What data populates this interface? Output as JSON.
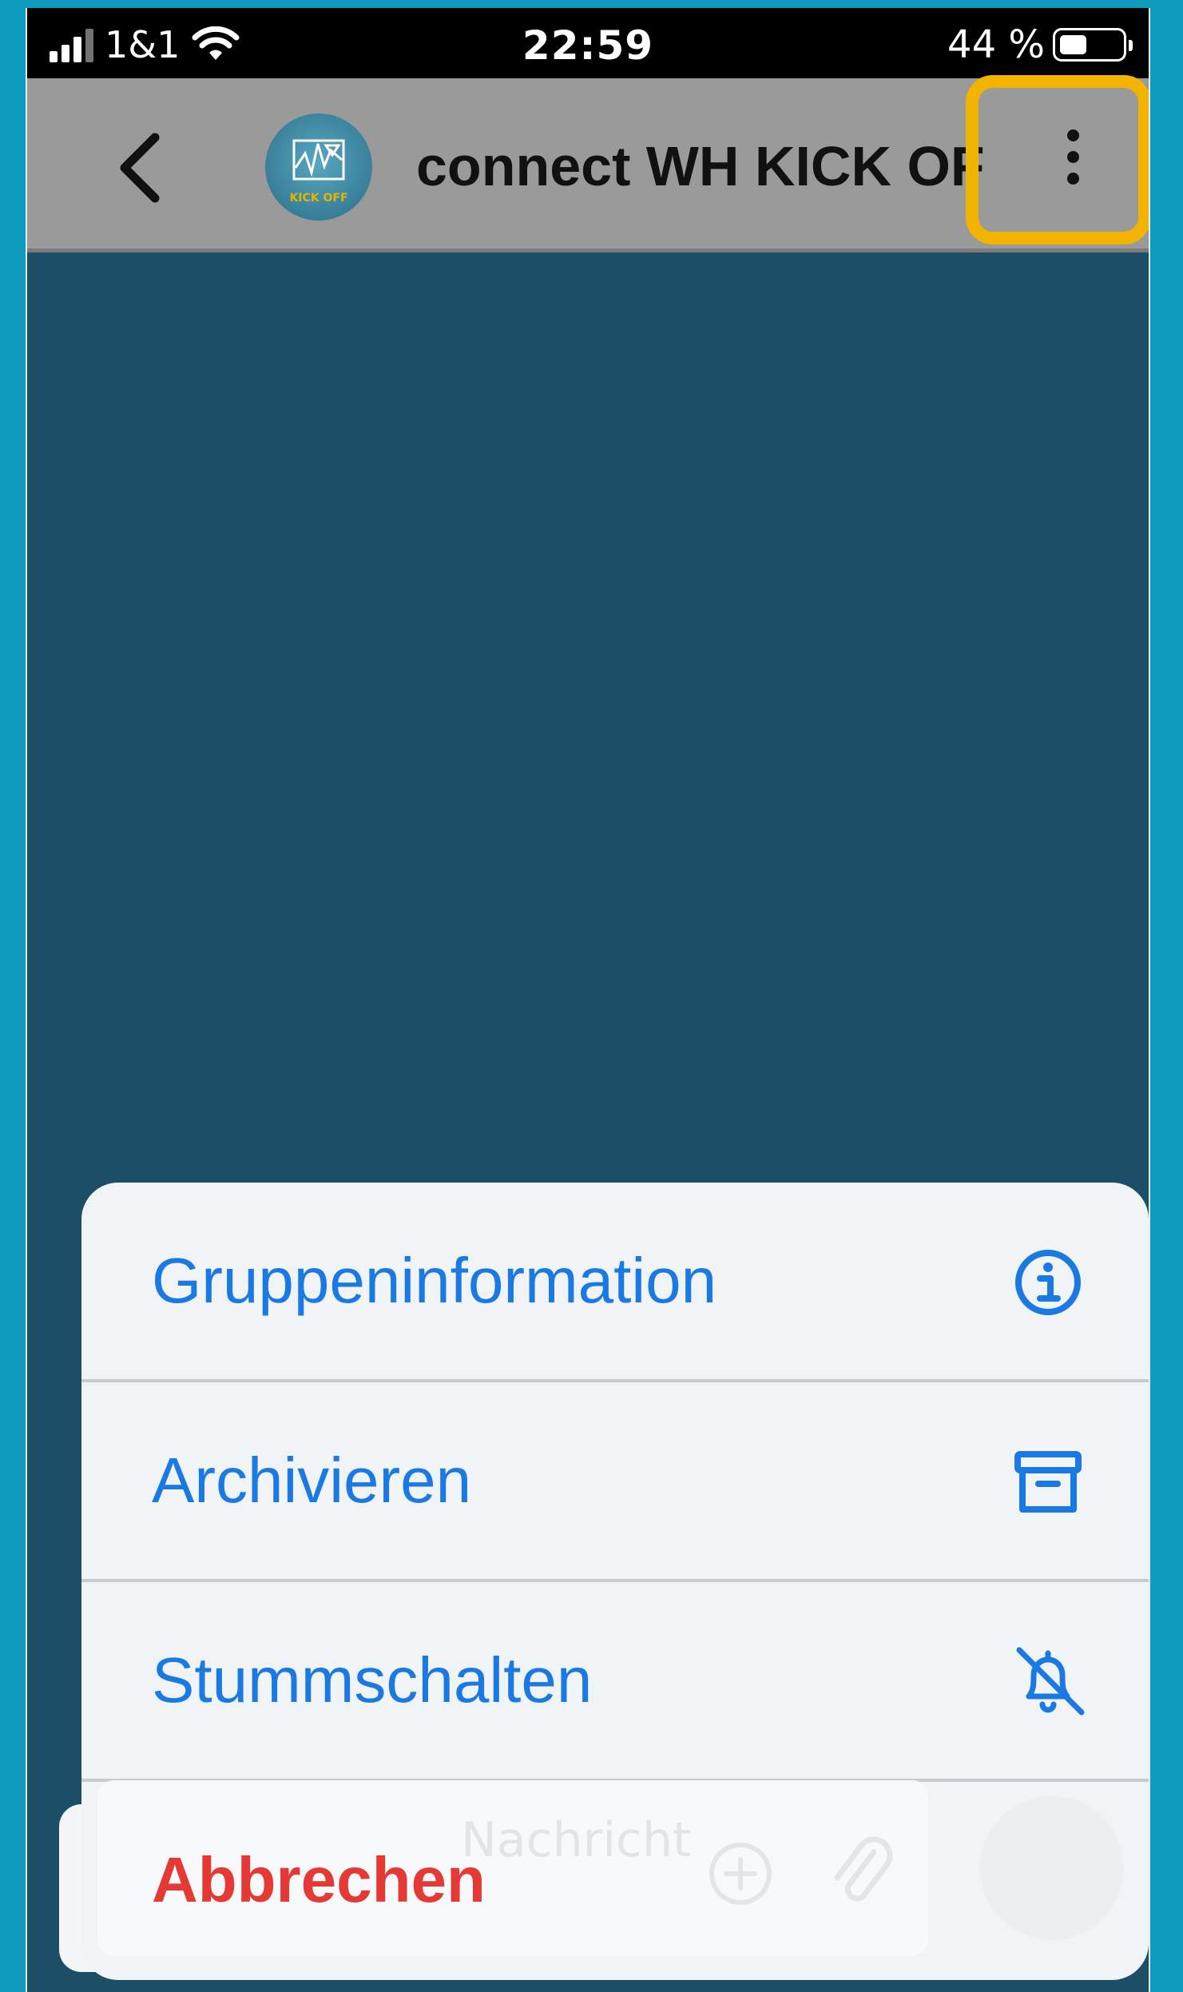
{
  "status_bar": {
    "carrier": "1&1",
    "time": "22:59",
    "battery": "44 %",
    "battery_level": 0.44
  },
  "header": {
    "title": "connect WH KICK OFF",
    "avatar_text": "KICK OFF"
  },
  "composer": {
    "placeholder": "Nachricht"
  },
  "action_sheet": {
    "items": [
      {
        "label": "Gruppeninformation",
        "icon": "info-circle-icon"
      },
      {
        "label": "Archivieren",
        "icon": "archive-box-icon"
      },
      {
        "label": "Stummschalten",
        "icon": "bell-slash-icon"
      }
    ],
    "cancel_label": "Abbrechen"
  },
  "colors": {
    "accent": "#1a79e3",
    "cancel": "#e53935",
    "highlight": "#f3b400",
    "chat_background": "#1d4e67"
  }
}
